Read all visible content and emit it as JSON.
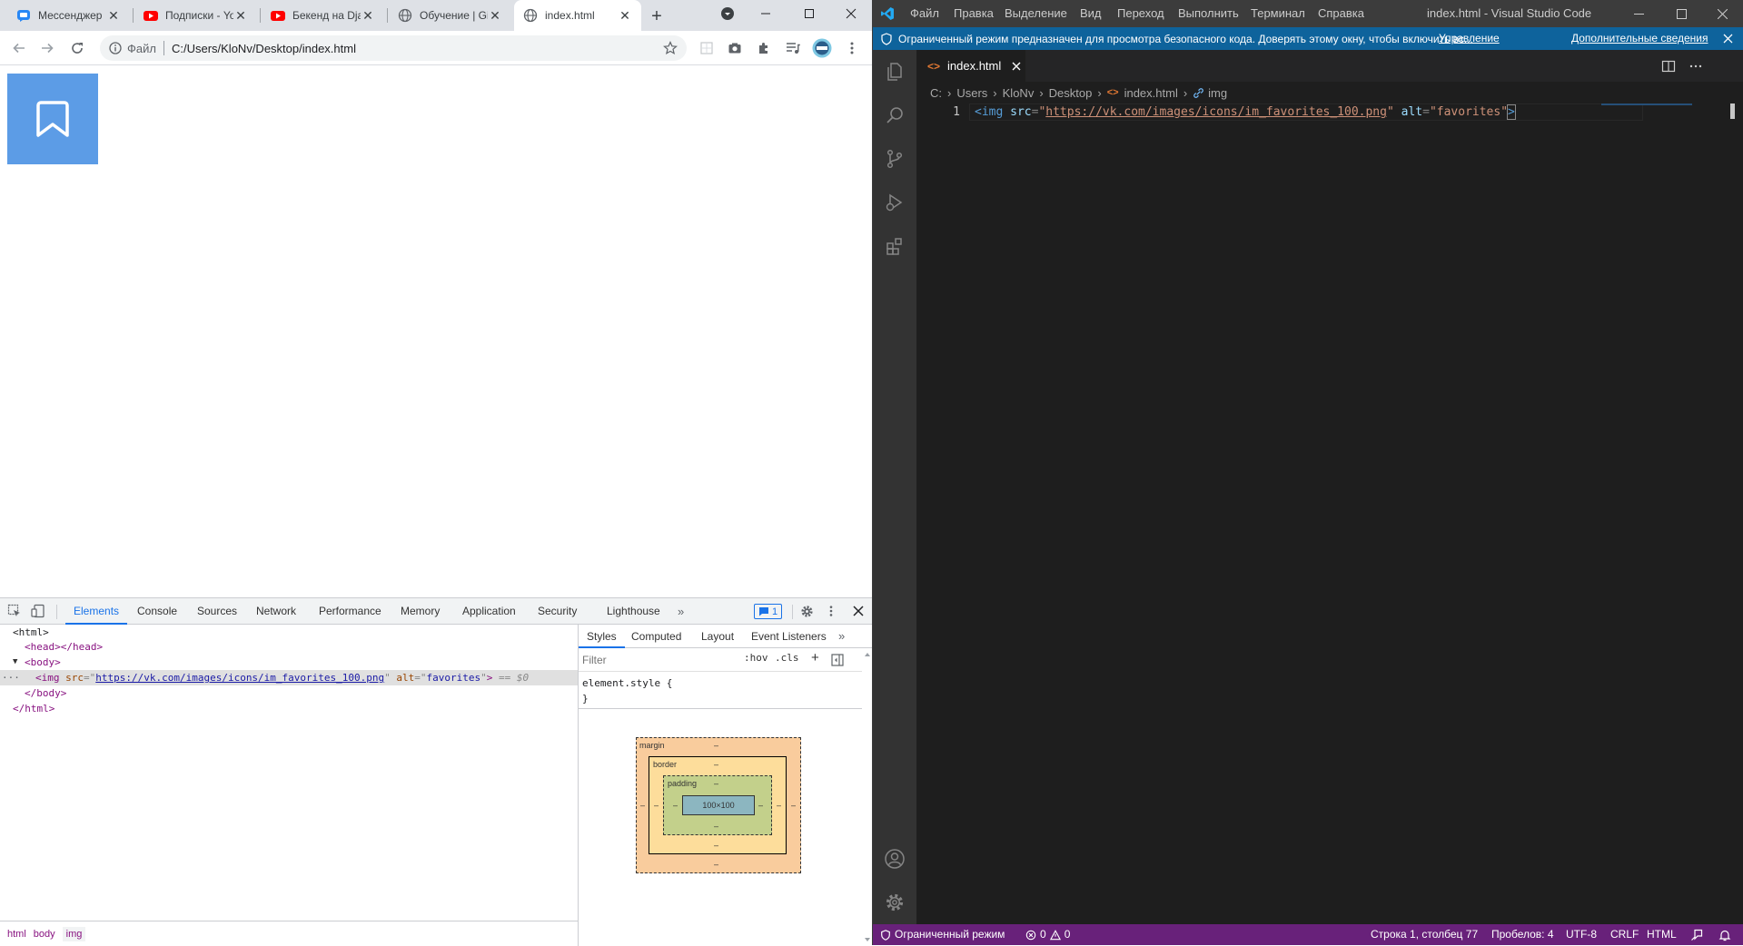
{
  "chrome": {
    "tabs": [
      {
        "title": "Мессенджер",
        "icon": "vk-messenger-icon",
        "active": false
      },
      {
        "title": "Подписки - YouTube",
        "icon": "youtube-icon",
        "active": false
      },
      {
        "title": "Бекенд на Django",
        "icon": "youtube-icon",
        "active": false
      },
      {
        "title": "Обучение | GitHub",
        "icon": "globe-icon",
        "active": false
      },
      {
        "title": "index.html",
        "icon": "globe-icon",
        "active": true
      }
    ],
    "address": {
      "scheme_label": "Файл",
      "url": "C:/Users/KloNv/Desktop/index.html"
    },
    "page": {
      "image_alt": "favorites",
      "image_icon": "bookmark-icon"
    },
    "devtools": {
      "tabs": [
        "Elements",
        "Console",
        "Sources",
        "Network",
        "Performance",
        "Memory",
        "Application",
        "Security",
        "Lighthouse"
      ],
      "issues_count": "1",
      "tree": {
        "html_open": "<html>",
        "head": "<head></head>",
        "body_open": "<body>",
        "img_tag": "<img",
        "img_src_attr": "src",
        "img_src": "https://vk.com/images/icons/im_favorites_100.png",
        "img_alt_attr": "alt",
        "img_alt": "favorites",
        "img_close": ">",
        "img_marker": "== $0",
        "body_close": "</body>",
        "html_close": "</html>"
      },
      "breadcrumbs": [
        "html",
        "body",
        "img"
      ],
      "styles_tabs": [
        "Styles",
        "Computed",
        "Layout",
        "Event Listeners"
      ],
      "filter_placeholder": "Filter",
      "hov": ":hov",
      "cls": ".cls",
      "element_style_open": "element.style {",
      "element_style_close": "}",
      "box_model": {
        "margin_label": "margin",
        "border_label": "border",
        "padding_label": "padding",
        "content": "100×100",
        "dash": "–"
      }
    }
  },
  "vscode": {
    "menu": [
      "Файл",
      "Правка",
      "Выделение",
      "Вид",
      "Переход",
      "Выполнить",
      "Терминал",
      "Справка"
    ],
    "window_title": "index.html - Visual Studio Code",
    "banner": {
      "text": "Ограниченный режим предназначен для просмотра безопасного кода. Доверять этому окну, чтобы включить вс...",
      "link_manage": "Управление",
      "link_more": "Дополнительные сведения"
    },
    "tab": {
      "title": "index.html"
    },
    "breadcrumbs": [
      "C:",
      "Users",
      "KloNv",
      "Desktop",
      "index.html",
      "img"
    ],
    "code": {
      "line_number": "1",
      "tag_open": "<img",
      "src_attr": "src",
      "src_value": "https://vk.com/images/icons/im_favorites_100.png",
      "alt_attr": "alt",
      "alt_value": "favorites",
      "tag_close": ">"
    },
    "status": {
      "restricted": "Ограниченный режим",
      "errors": "0",
      "warnings": "0",
      "position": "Строка 1, столбец 77",
      "spaces": "Пробелов: 4",
      "encoding": "UTF-8",
      "eol": "CRLF",
      "language": "HTML"
    }
  }
}
